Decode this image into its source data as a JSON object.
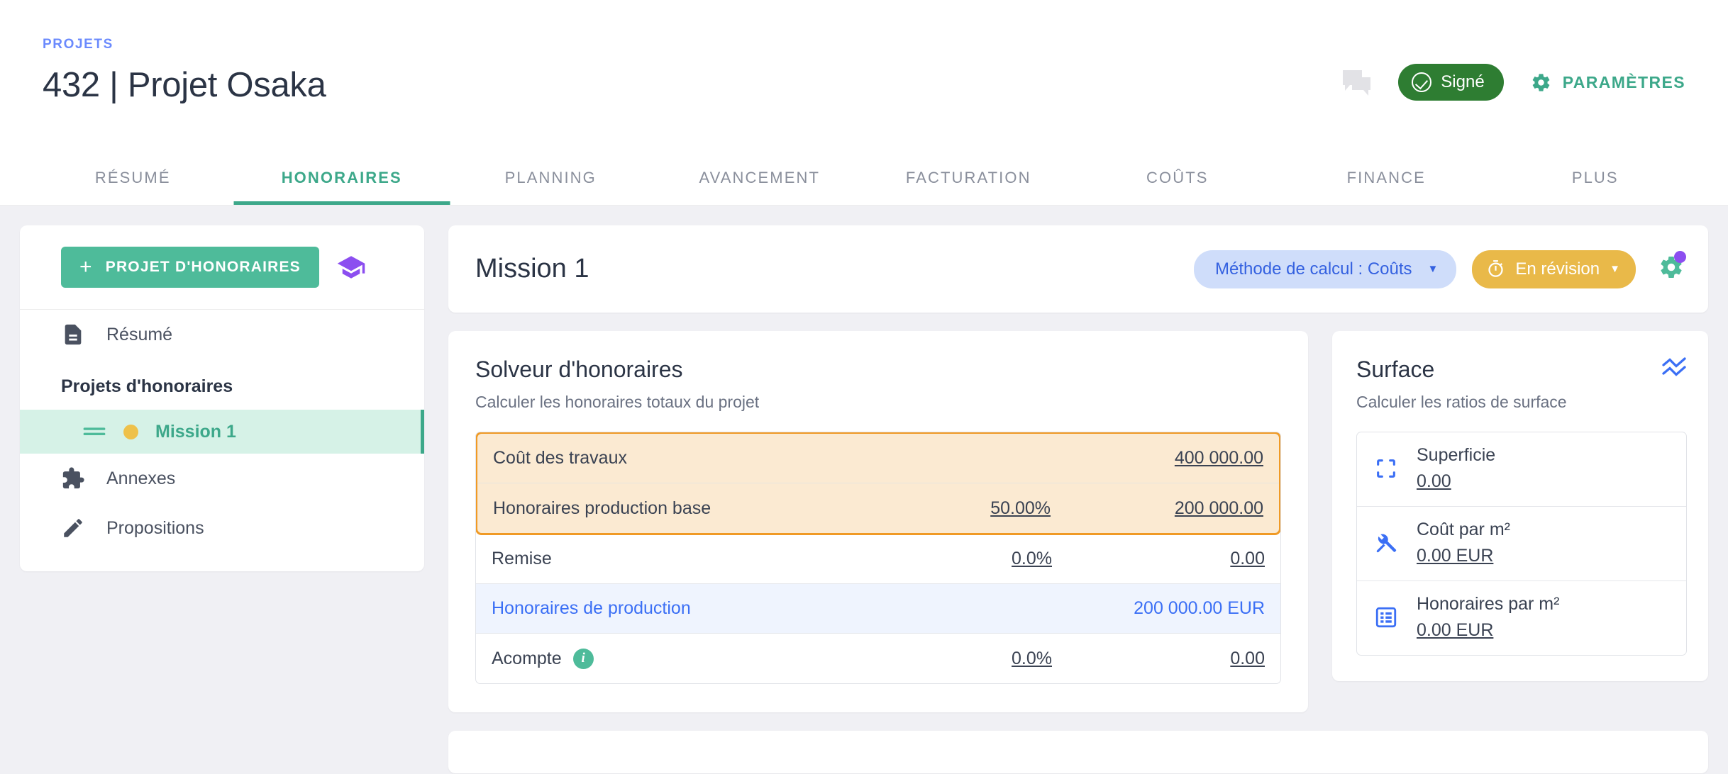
{
  "header": {
    "breadcrumb": "PROJETS",
    "title": "432 | Projet Osaka",
    "comment_icon": "comment-bubbles-icon",
    "status_label": "Signé",
    "status_color": "#2e7d32",
    "settings_label": "PARAMÈTRES",
    "settings_icon": "gear-icon",
    "settings_color": "#3da88a"
  },
  "tabs": [
    {
      "label": "RÉSUMÉ",
      "active": false
    },
    {
      "label": "HONORAIRES",
      "active": true
    },
    {
      "label": "PLANNING",
      "active": false
    },
    {
      "label": "AVANCEMENT",
      "active": false
    },
    {
      "label": "FACTURATION",
      "active": false
    },
    {
      "label": "COÛTS",
      "active": false
    },
    {
      "label": "FINANCE",
      "active": false
    },
    {
      "label": "PLUS",
      "active": false
    }
  ],
  "sidebar": {
    "add_button_label": "PROJET D'HONORAIRES",
    "add_button_plus": "+",
    "add_button_color": "#4ebb9a",
    "graduation_icon": "graduation-cap-icon",
    "graduation_color": "#8c4ef0",
    "items": [
      {
        "label": "Résumé",
        "icon": "document-icon"
      }
    ],
    "section_label": "Projets d'honoraires",
    "mission": {
      "label": "Mission 1",
      "drag_icon": "drag-handle-icon",
      "status_dot_color": "#eec14a",
      "highlight_color": "#d6f2e7",
      "text_color": "#3da88a"
    },
    "items_after": [
      {
        "label": "Annexes",
        "icon": "puzzle-icon"
      },
      {
        "label": "Propositions",
        "icon": "pencil-icon"
      }
    ]
  },
  "mission_header": {
    "title": "Mission 1",
    "method_pill": "Méthode de calcul : Coûts",
    "method_caret": "▼",
    "method_color": "#3461e0",
    "status_pill": "En révision",
    "status_caret": "▼",
    "status_color": "#e9b949",
    "timer_icon": "timer-icon",
    "gear_icon": "gear-icon",
    "gear_badge_color": "#8c4ef0"
  },
  "solver": {
    "title": "Solveur d'honoraires",
    "subtitle": "Calculer les honoraires totaux du projet",
    "highlight_border": "#f09a25",
    "highlight_fill": "#fbead2",
    "rows": [
      {
        "label": "Coût des travaux",
        "pct": "",
        "amount": "400 000.00",
        "highlighted": true
      },
      {
        "label": "Honoraires production base",
        "pct": "50.00%",
        "amount": "200 000.00",
        "highlighted": true
      },
      {
        "label": "Remise",
        "pct": "0.0%",
        "amount": "0.00",
        "highlighted": false
      },
      {
        "label": "Honoraires de production",
        "pct": "",
        "amount": "200 000.00 EUR",
        "highlighted": false,
        "emphasis": true
      },
      {
        "label": "Acompte",
        "pct": "0.0%",
        "amount": "0.00",
        "highlighted": false,
        "info_icon": "info-icon"
      }
    ]
  },
  "surface": {
    "title": "Surface",
    "subtitle": "Calculer les ratios de surface",
    "chart_icon": "wave-chart-icon",
    "rows": [
      {
        "label": "Superficie",
        "value": "0.00",
        "icon": "crop-frame-icon"
      },
      {
        "label": "Coût par m²",
        "value": "0.00 EUR",
        "icon": "tools-icon"
      },
      {
        "label": "Honoraires par m²",
        "value": "0.00 EUR",
        "icon": "list-icon"
      }
    ]
  }
}
